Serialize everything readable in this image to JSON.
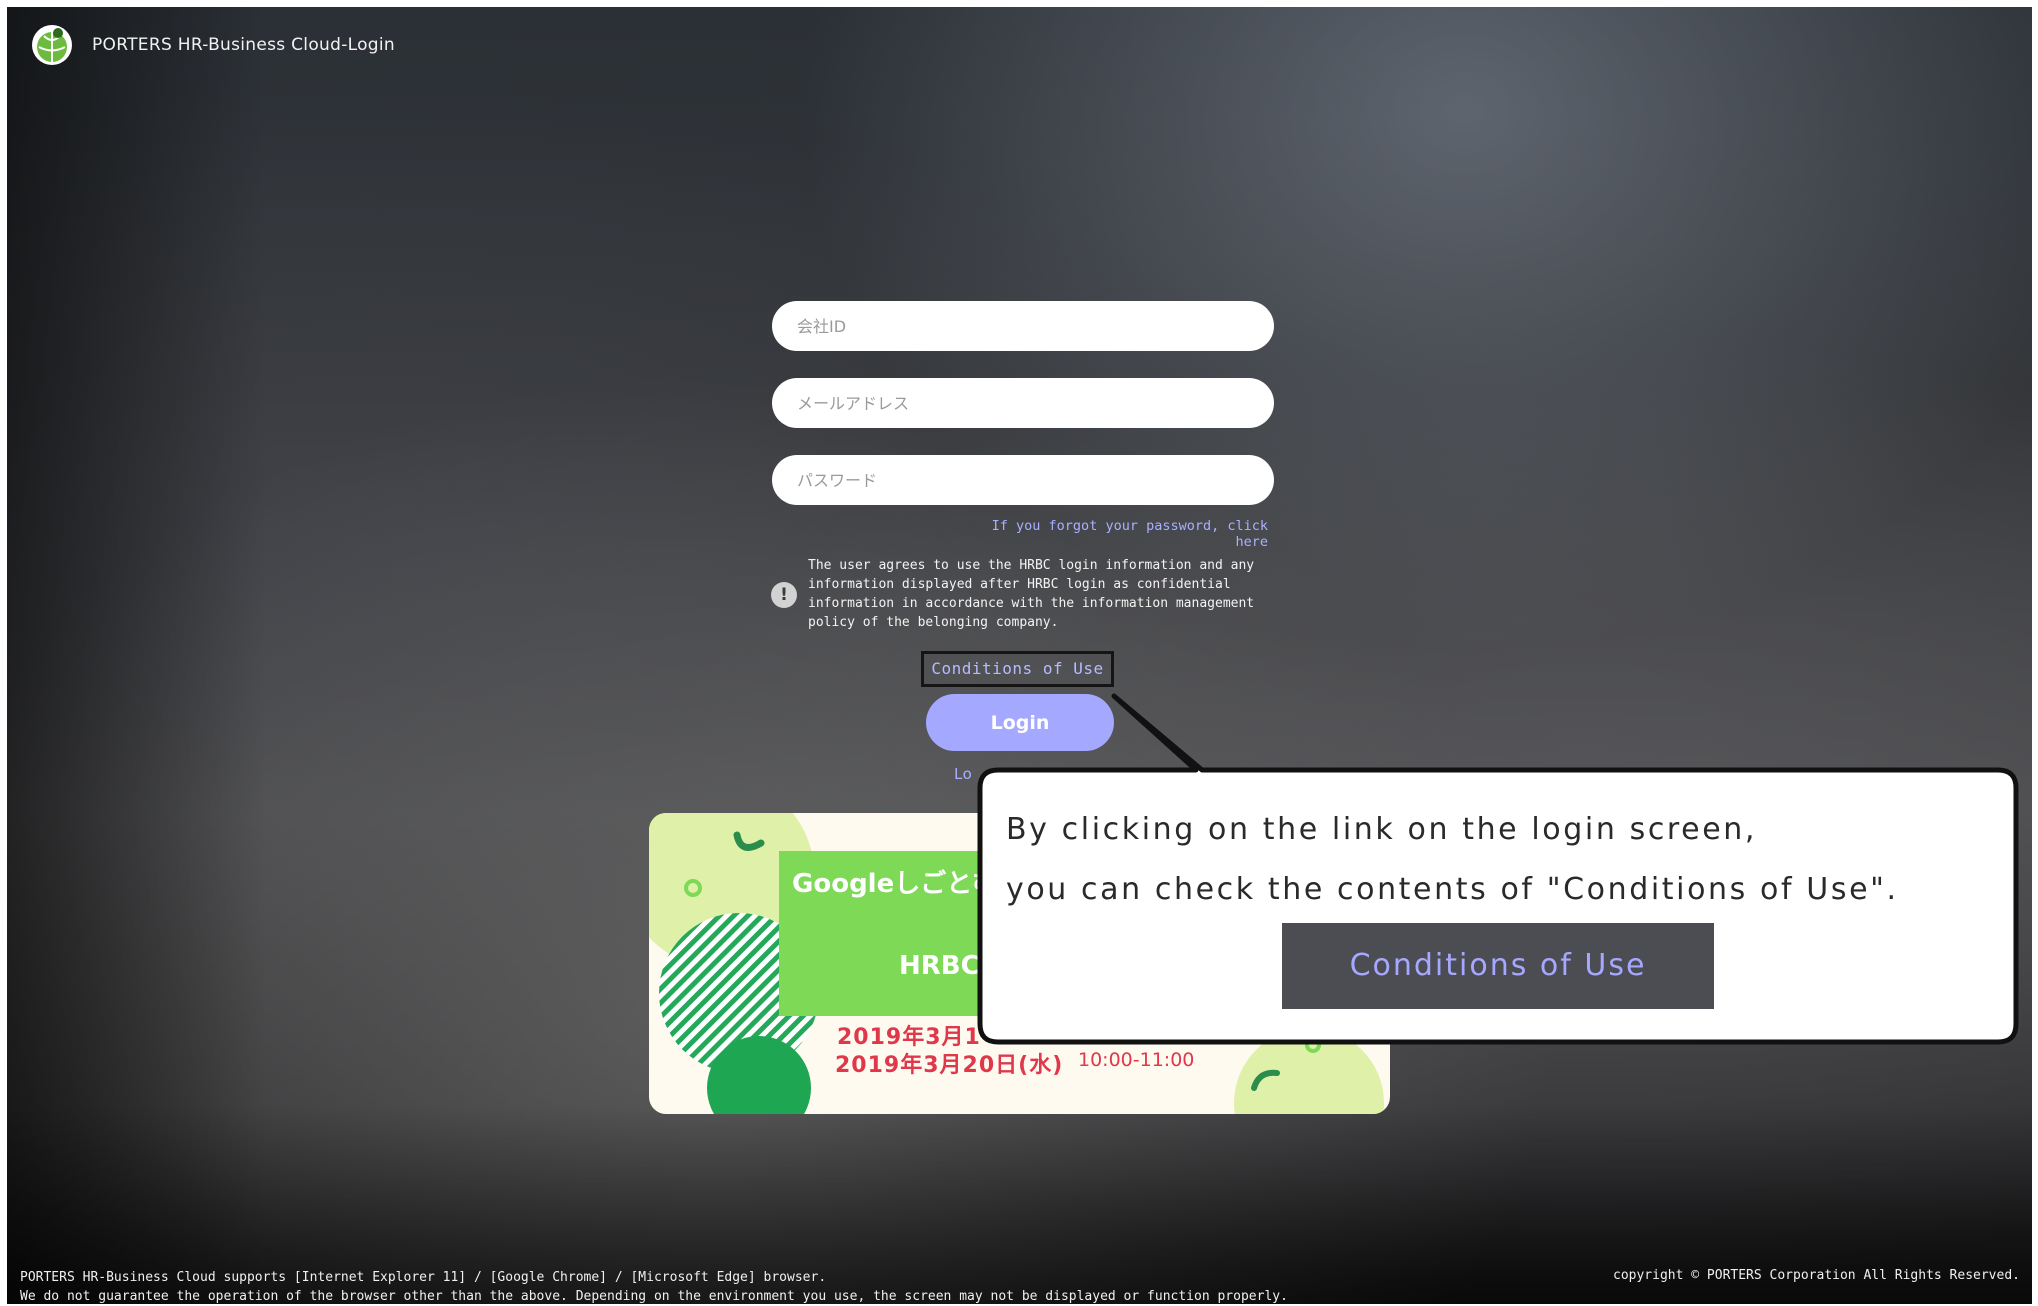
{
  "brand": {
    "title": "PORTERS HR-Business Cloud-Login"
  },
  "form": {
    "company_id_placeholder": "会社ID",
    "email_placeholder": "メールアドレス",
    "password_placeholder": "パスワード",
    "forgot_link": "If you forgot your password, click here",
    "notice_line1": "The user agrees to use the HRBC login information and any",
    "notice_line2": "information displayed after HRBC login as confidential",
    "notice_line3": "information in accordance with the information management",
    "notice_line4": "policy of the belonging company.",
    "notice_icon": "exclamation-icon",
    "conditions_link": "Conditions of Use",
    "login_button": "Login",
    "partial_link": "Lo"
  },
  "banner": {
    "title": "Googleしごとむ",
    "sub": "HRBC",
    "date1": "2019年3月1",
    "date2": "2019年3月20日(水)",
    "time": "10:00-11:00"
  },
  "callout": {
    "line1": "By clicking on the link on the login screen,",
    "line2": "you can check the contents of \"Conditions of Use\".",
    "button": "Conditions of Use"
  },
  "footer": {
    "support_line1": "PORTERS HR-Business Cloud supports [Internet Explorer 11] / [Google Chrome] / [Microsoft Edge] browser.",
    "support_line2": "We do not guarantee the operation of the browser other than the above. Depending on the environment you use, the screen may not be displayed or function properly.",
    "copyright": "copyright © PORTERS Corporation All Rights Reserved."
  },
  "colors": {
    "accent": "#a4a8ff",
    "link": "#a9b0ff",
    "banner_green": "#7ed957",
    "banner_red": "#e0384b"
  }
}
